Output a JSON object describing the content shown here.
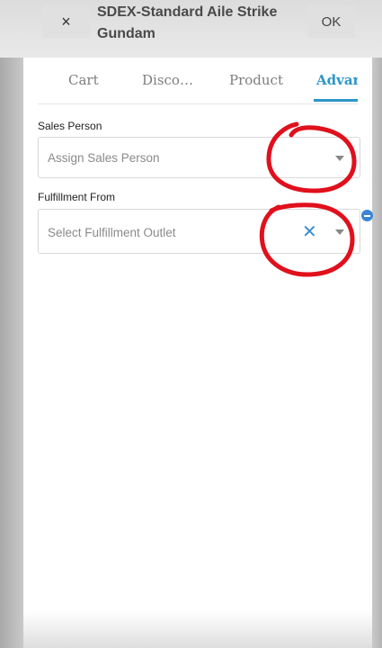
{
  "header": {
    "close_icon": "×",
    "title": "SDEX-Standard Aile Strike Gundam",
    "ok_label": "OK"
  },
  "tabs": [
    {
      "label": "Cart"
    },
    {
      "label": "Disco…"
    },
    {
      "label": "Product"
    },
    {
      "label": "Advar",
      "active": true
    }
  ],
  "fields": {
    "sales_person": {
      "label": "Sales Person",
      "placeholder": "Assign Sales Person"
    },
    "fulfillment": {
      "label": "Fulfillment From",
      "placeholder": "Select Fulfillment Outlet",
      "clear_icon": "✕"
    }
  },
  "colors": {
    "accent": "#2d96c9",
    "annotation": "#e0101c"
  }
}
